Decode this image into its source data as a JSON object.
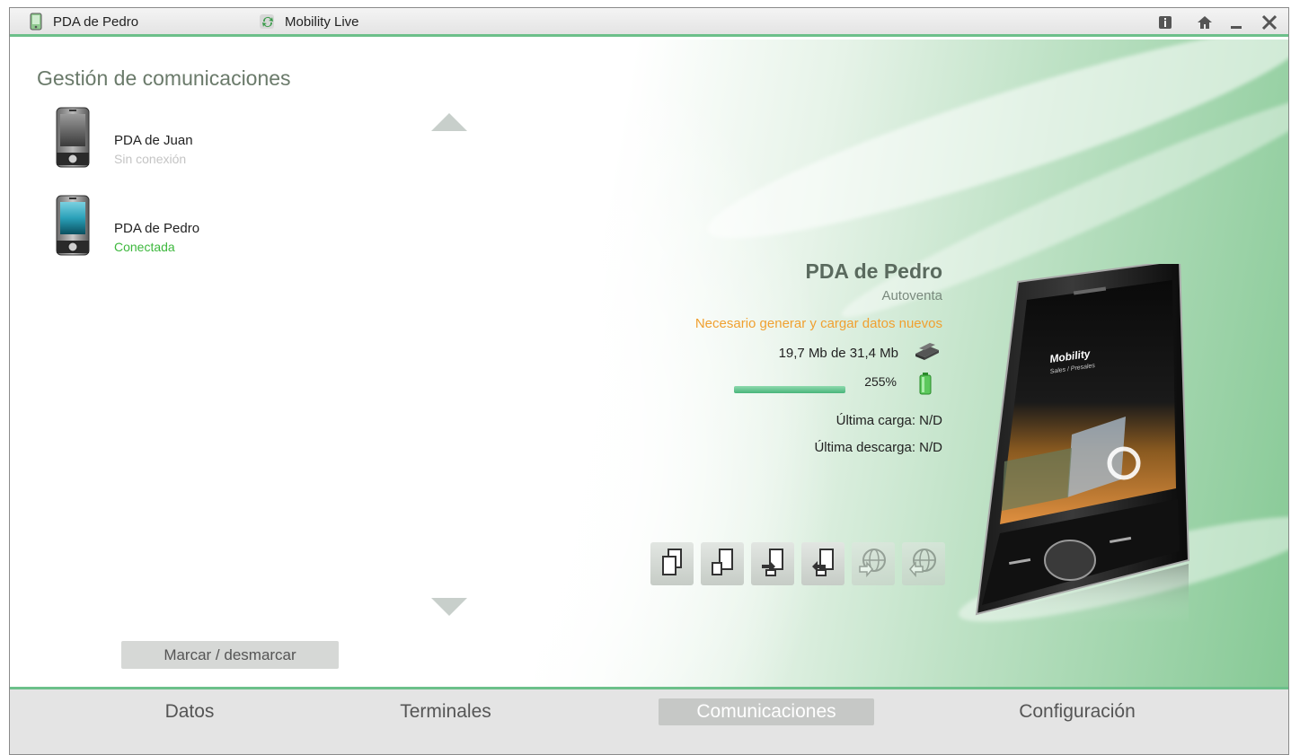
{
  "titlebar": {
    "device_label": "PDA de Pedro",
    "app_label": "Mobility Live"
  },
  "page": {
    "title": "Gestión de comunicaciones"
  },
  "devices": [
    {
      "name": "PDA de Juan",
      "status": "Sin conexión",
      "status_color": "#c4c4c4",
      "connected": false
    },
    {
      "name": "PDA de Pedro",
      "status": "Conectada",
      "status_color": "#3db83d",
      "connected": true
    }
  ],
  "mark_button_label": "Marcar / desmarcar",
  "detail": {
    "name": "PDA de Pedro",
    "profile": "Autoventa",
    "warning": "Necesario generar y cargar datos nuevos",
    "memory": "19,7 Mb de 31,4 Mb",
    "percent": "255%",
    "progress_fraction": 1.0,
    "last_upload": "Última carga: N/D",
    "last_download": "Última descarga: N/D"
  },
  "phone_screen": {
    "brand": "Mobility",
    "subtitle": "Sales / Presales"
  },
  "actions": [
    {
      "icon": "copy-pages-icon",
      "enabled": true
    },
    {
      "icon": "page-icon",
      "enabled": true
    },
    {
      "icon": "page-import-icon",
      "enabled": true
    },
    {
      "icon": "page-export-icon",
      "enabled": true
    },
    {
      "icon": "globe-download-icon",
      "enabled": false
    },
    {
      "icon": "globe-upload-icon",
      "enabled": false
    }
  ],
  "nav": {
    "datos": "Datos",
    "terminales": "Terminales",
    "comunicaciones": "Comunicaciones",
    "configuracion": "Configuración",
    "active": "comunicaciones"
  },
  "colors": {
    "accent": "#6cc08a",
    "warning": "#f0a030",
    "connected": "#3db83d"
  }
}
